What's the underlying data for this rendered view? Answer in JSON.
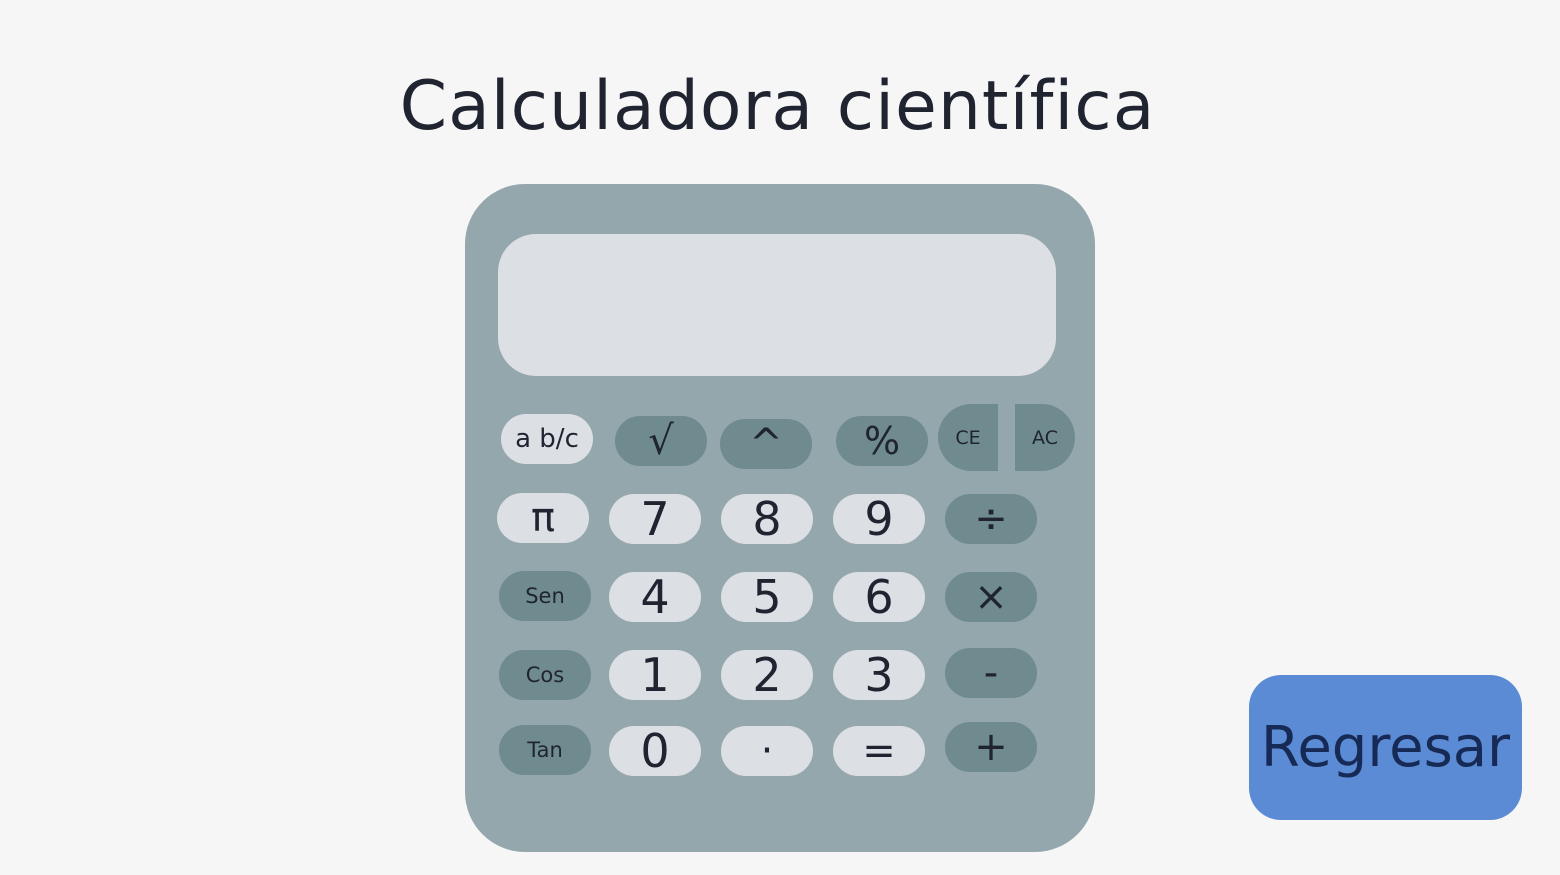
{
  "title": "Calculadora científica",
  "display": {
    "value": ""
  },
  "keys": {
    "frac": "a b/c",
    "sqrt": "√",
    "pow": "^",
    "percent": "%",
    "ce": "CE",
    "ac": "AC",
    "pi": "π",
    "seven": "7",
    "eight": "8",
    "nine": "9",
    "divide": "÷",
    "sin": "Sen",
    "four": "4",
    "five": "5",
    "six": "6",
    "multiply": "×",
    "cos": "Cos",
    "one": "1",
    "two": "2",
    "three": "3",
    "minus": "-",
    "tan": "Tan",
    "zero": "0",
    "dot": "·",
    "equals": "=",
    "plus": "+"
  },
  "back_button": "Regresar",
  "colors": {
    "background": "#f6f6f6",
    "calculator_body": "#94a7ac",
    "display": "#dcdfe4",
    "light_key": "#dcdfe4",
    "dark_key": "#6f8b8f",
    "back_button": "#5b8bd4"
  }
}
